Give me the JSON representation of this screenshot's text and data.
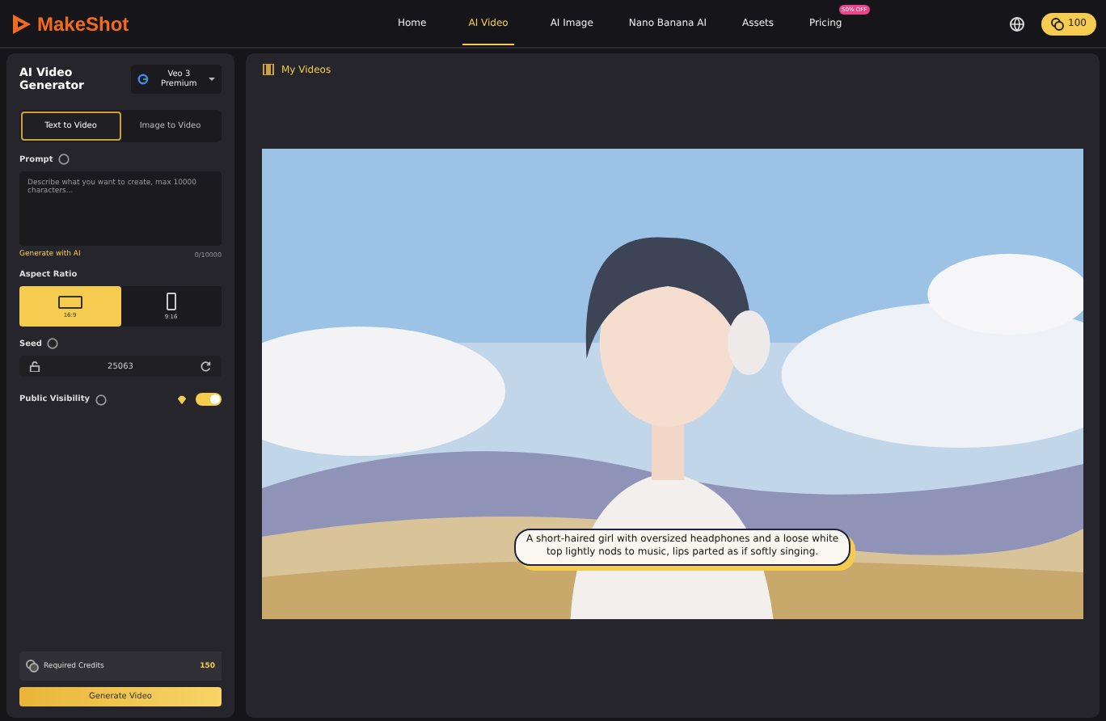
{
  "header": {
    "logo": "MakeShot",
    "nav": [
      {
        "label": "Home",
        "selected": false
      },
      {
        "label": "AI Video",
        "selected": true
      },
      {
        "label": "AI Image",
        "selected": false
      },
      {
        "label": "Nano Banana AI",
        "selected": false
      },
      {
        "label": "Assets",
        "selected": false
      },
      {
        "label": "Pricing",
        "selected": false,
        "badge": "50% OFF"
      }
    ],
    "credits": "100"
  },
  "generator": {
    "title": "AI Video Generator",
    "model": "Veo 3 Premium",
    "modes": [
      {
        "label": "Text to Video",
        "selected": true
      },
      {
        "label": "Image to Video",
        "selected": false
      }
    ],
    "prompt_label": "Prompt",
    "prompt_placeholder": "Describe what you want to create, max 10000 characters...",
    "generate_ai": "Generate with AI",
    "char_count": "0/10000",
    "aspect_label": "Aspect Ratio",
    "aspects": [
      {
        "label": "16:9",
        "kind": "landscape",
        "selected": true
      },
      {
        "label": "9:16",
        "kind": "portrait",
        "selected": false
      }
    ],
    "seed_label": "Seed",
    "seed": "25063",
    "visibility_label": "Public Visibility",
    "visibility_on": true,
    "credits_label": "Required Credits",
    "credits_value": "150",
    "button": "Generate Video"
  },
  "videos": {
    "title": "My Videos",
    "caption": "A short-haired girl with oversized headphones and a loose white top lightly nods to music, lips parted as if softly singing."
  }
}
